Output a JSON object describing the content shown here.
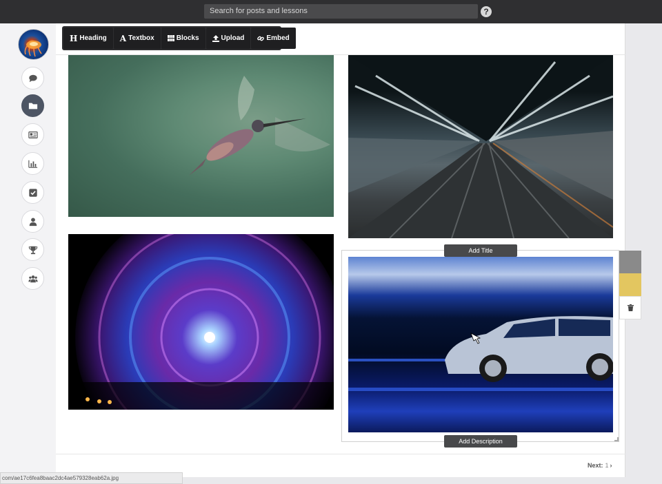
{
  "topbar": {
    "search_placeholder": "Search for posts and lessons",
    "help_label": "?"
  },
  "sidebar": {
    "items": [
      {
        "icon": "chat-icon"
      },
      {
        "icon": "folder-icon",
        "active": true
      },
      {
        "icon": "id-card-icon"
      },
      {
        "icon": "bar-chart-icon"
      },
      {
        "icon": "checkbox-icon"
      },
      {
        "icon": "user-icon"
      },
      {
        "icon": "trophy-icon"
      },
      {
        "icon": "users-icon"
      }
    ]
  },
  "toolbar": {
    "heading": "Heading",
    "textbox": "Textbox",
    "blocks": "Blocks",
    "upload": "Upload",
    "embed": "Embed"
  },
  "gallery": {
    "add_title": "Add Title",
    "add_description": "Add Description"
  },
  "colors": {
    "swatch_gray": "#8a8a8a",
    "swatch_yellow": "#e3c660"
  },
  "pagination": {
    "next_label": "Next:",
    "next_page": "1"
  },
  "status": {
    "url": "com/ae17c6fea8baac2dc4ae579328eab62a.jpg"
  }
}
